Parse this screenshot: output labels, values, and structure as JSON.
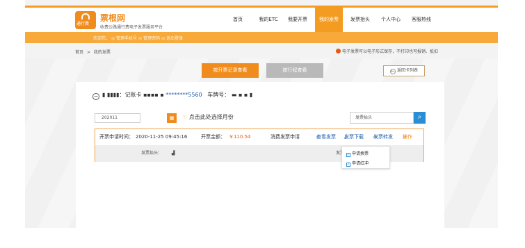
{
  "header": {
    "logo_text": "通行费",
    "brand": "票根网",
    "slogan": "收费公路通行费电子发票服务平台",
    "nav": [
      {
        "label": "首页",
        "active": false
      },
      {
        "label": "我的ETC",
        "active": false
      },
      {
        "label": "我要开票",
        "active": false
      },
      {
        "label": "我的发票",
        "active": true
      },
      {
        "label": "发票抬头",
        "active": false
      },
      {
        "label": "个人中心",
        "active": false
      },
      {
        "label": "客服热线",
        "active": false
      }
    ],
    "accent_color": "#f39c21"
  },
  "band": {
    "text": "欢迎您，  ◎ 管理手机号  ◎ 管理密码  ◎ 退出登录"
  },
  "breadcrumb": {
    "home": "首页",
    "separator": ">",
    "current": "我的发票"
  },
  "notice": "电子发票可以电子形式保存，不打印也可报销、抵扣",
  "actions": {
    "by_record": "按开票记录查看",
    "by_trip": "按行程查看",
    "back_to_cards": "返回卡列表"
  },
  "card": {
    "prefix": "▮ ▮▮▮▮：记账卡 ▪▪▪▪ ▪",
    "card_number": "********5560",
    "plate_label": "车牌号：",
    "plate_value": "▬ ▪ ▪  ▮"
  },
  "filter": {
    "month_value": "202011",
    "month_hint": "点击此处选择月份",
    "search_placeholder": "发票抬头"
  },
  "record": {
    "apply_time_label": "开票申请时间：",
    "apply_time": "2020-11-25 09:45:16",
    "amount_label": "开票金额：",
    "amount": "￥110.54",
    "type": "消费发票申请",
    "view_invoice": "查看发票",
    "download_invoice": "发票下载",
    "send_invoice": "发票转发",
    "operate": "操作",
    "title_label": "发票抬头：",
    "title_value": "▟",
    "count_label": "发票数量："
  },
  "dropdown": {
    "items": [
      "申请换票",
      "申请红冲"
    ]
  }
}
